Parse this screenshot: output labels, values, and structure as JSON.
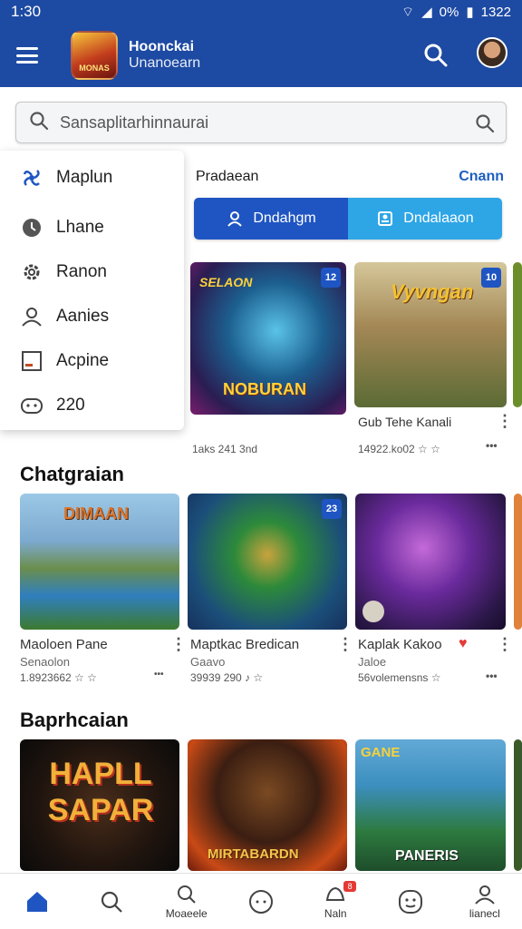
{
  "status": {
    "time": "1:30",
    "battery": "0%",
    "clock": "1322"
  },
  "app": {
    "title": "Hoonckai",
    "subtitle": "Unanoearn",
    "logo_text": "MONAS"
  },
  "search": {
    "placeholder": "Sansaplitarhinnaurai"
  },
  "menu": {
    "items": [
      {
        "label": "Maplun",
        "icon": "fan-icon"
      },
      {
        "label": "Lhane",
        "icon": "clock-icon"
      },
      {
        "label": "Ranon",
        "icon": "gear-icon"
      },
      {
        "label": "Aanies",
        "icon": "user-icon"
      },
      {
        "label": "Acpine",
        "icon": "image-icon"
      },
      {
        "label": "220",
        "icon": "game-icon"
      }
    ]
  },
  "section1": {
    "title": "Pradaean",
    "see": "Cnann"
  },
  "toggle": {
    "a": "Dndahgm",
    "b": "Dndalaaon"
  },
  "row1": [
    {
      "badge": "12",
      "art": "NOBURAN",
      "art_top": "SELAON",
      "meta": "1aks 241 3nd"
    },
    {
      "badge": "10",
      "art": "Vyvngan",
      "name": "Gub Tehe Kanali",
      "meta": "14922.ko02 ☆ ☆"
    }
  ],
  "section2": {
    "title": "Chatgraian"
  },
  "row2": [
    {
      "art": "DIMAAN",
      "name": "Maoloen Pane",
      "sub": "Senaolon",
      "meta": "1.8923662 ☆ ☆"
    },
    {
      "art": "",
      "badge": "23",
      "name": "Maptkac Bredican",
      "sub": "Gaavo",
      "meta": "39939 290 ♪ ☆"
    },
    {
      "art": "",
      "name": "Kaplak Kakoo",
      "sub": "Jaloe",
      "meta": "56volemensns ☆"
    }
  ],
  "section3": {
    "title": "Baprhcaian"
  },
  "row3": [
    {
      "art": "HAPLL SAPAR"
    },
    {
      "art": "MIRTABARDN"
    },
    {
      "art": "PANERIS",
      "art_top": "GANE"
    }
  ],
  "nav": [
    {
      "label": "",
      "icon": "home-icon"
    },
    {
      "label": "",
      "icon": "search-icon"
    },
    {
      "label": "Moaeele",
      "icon": "search-icon"
    },
    {
      "label": "",
      "icon": "game-icon"
    },
    {
      "label": "Naln",
      "icon": "bell-icon",
      "badge": "8"
    },
    {
      "label": "",
      "icon": "face-icon"
    },
    {
      "label": "lianecl",
      "icon": "user-icon"
    }
  ]
}
